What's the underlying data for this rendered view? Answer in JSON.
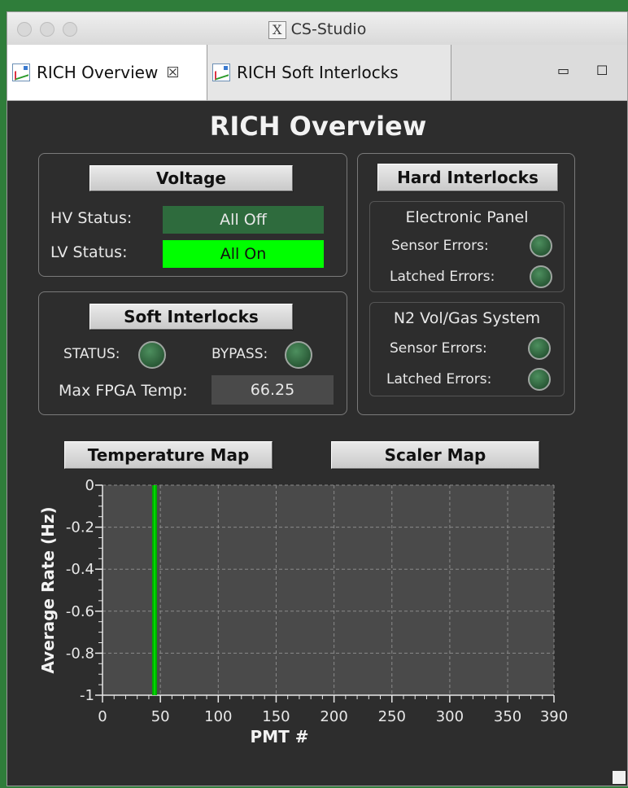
{
  "window": {
    "title": "CS-Studio"
  },
  "tabs": [
    {
      "label": "RICH Overview",
      "close": "☒"
    },
    {
      "label": "RICH Soft Interlocks"
    }
  ],
  "window_controls": {
    "minimize": "▭",
    "maximize": "☐"
  },
  "page_title": "RICH Overview",
  "voltage": {
    "button": "Voltage",
    "hv_label": "HV Status:",
    "hv_value": "All Off",
    "lv_label": "LV Status:",
    "lv_value": "All On"
  },
  "soft_interlocks": {
    "button": "Soft Interlocks",
    "status_label": "STATUS:",
    "bypass_label": "BYPASS:",
    "fpga_label": "Max FPGA Temp:",
    "fpga_value": "66.25"
  },
  "hard_interlocks": {
    "button": "Hard Interlocks",
    "electronic_panel": {
      "title": "Electronic Panel",
      "sensor_label": "Sensor Errors:",
      "latched_label": "Latched Errors:"
    },
    "n2_system": {
      "title": "N2 Vol/Gas System",
      "sensor_label": "Sensor Errors:",
      "latched_label": "Latched Errors:"
    }
  },
  "map_buttons": {
    "temperature": "Temperature Map",
    "scaler": "Scaler Map"
  },
  "colors": {
    "led_off": "#2f6b3f",
    "hv_off_bg": "#2e6b3d",
    "lv_on_bg": "#00ff00",
    "plot_bg": "#4a4a4a",
    "trace": "#00aa00"
  },
  "chart_data": {
    "type": "line",
    "xlabel": "PMT #",
    "ylabel": "Average Rate (Hz)",
    "xlim": [
      0,
      390
    ],
    "ylim": [
      -1,
      0
    ],
    "x_ticks": [
      "0",
      "50",
      "100",
      "150",
      "200",
      "250",
      "300",
      "350",
      "390"
    ],
    "y_ticks": [
      "0",
      "-0.2",
      "-0.4",
      "-0.6",
      "-0.8",
      "-1"
    ],
    "grid": true,
    "series": [
      {
        "x": [
          45,
          45
        ],
        "y": [
          0,
          -1
        ]
      }
    ]
  }
}
